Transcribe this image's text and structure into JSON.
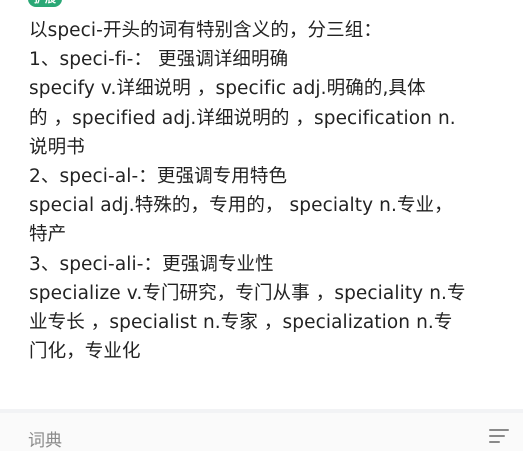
{
  "badge": {
    "label": "扩展"
  },
  "content": {
    "lines": [
      "以speci-开头的词有特别含义的，分三组：",
      "1、speci-fi-：  更强调详细明确",
      "specify v.详细说明 ，specific adj.明确的,具体",
      "的 ，specified adj.详细说明的 ，specification n.",
      "说明书",
      "2、speci-al-：更强调专用特色",
      "special  adj.特殊的，专用的， specialty n.专业，",
      "特产",
      "3、speci-ali-：更强调专业性",
      "specialize v.专门研究，专门从事 ，speciality n.专",
      "业专长 ，specialist n.专家 ，specialization n.专",
      "门化，专业化"
    ]
  },
  "bottom_bar": {
    "label": "词典",
    "menu_icon": "menu-lines-icon"
  },
  "colors": {
    "badge": "#2aa876",
    "text": "#222222",
    "muted": "#8a8a8a"
  }
}
